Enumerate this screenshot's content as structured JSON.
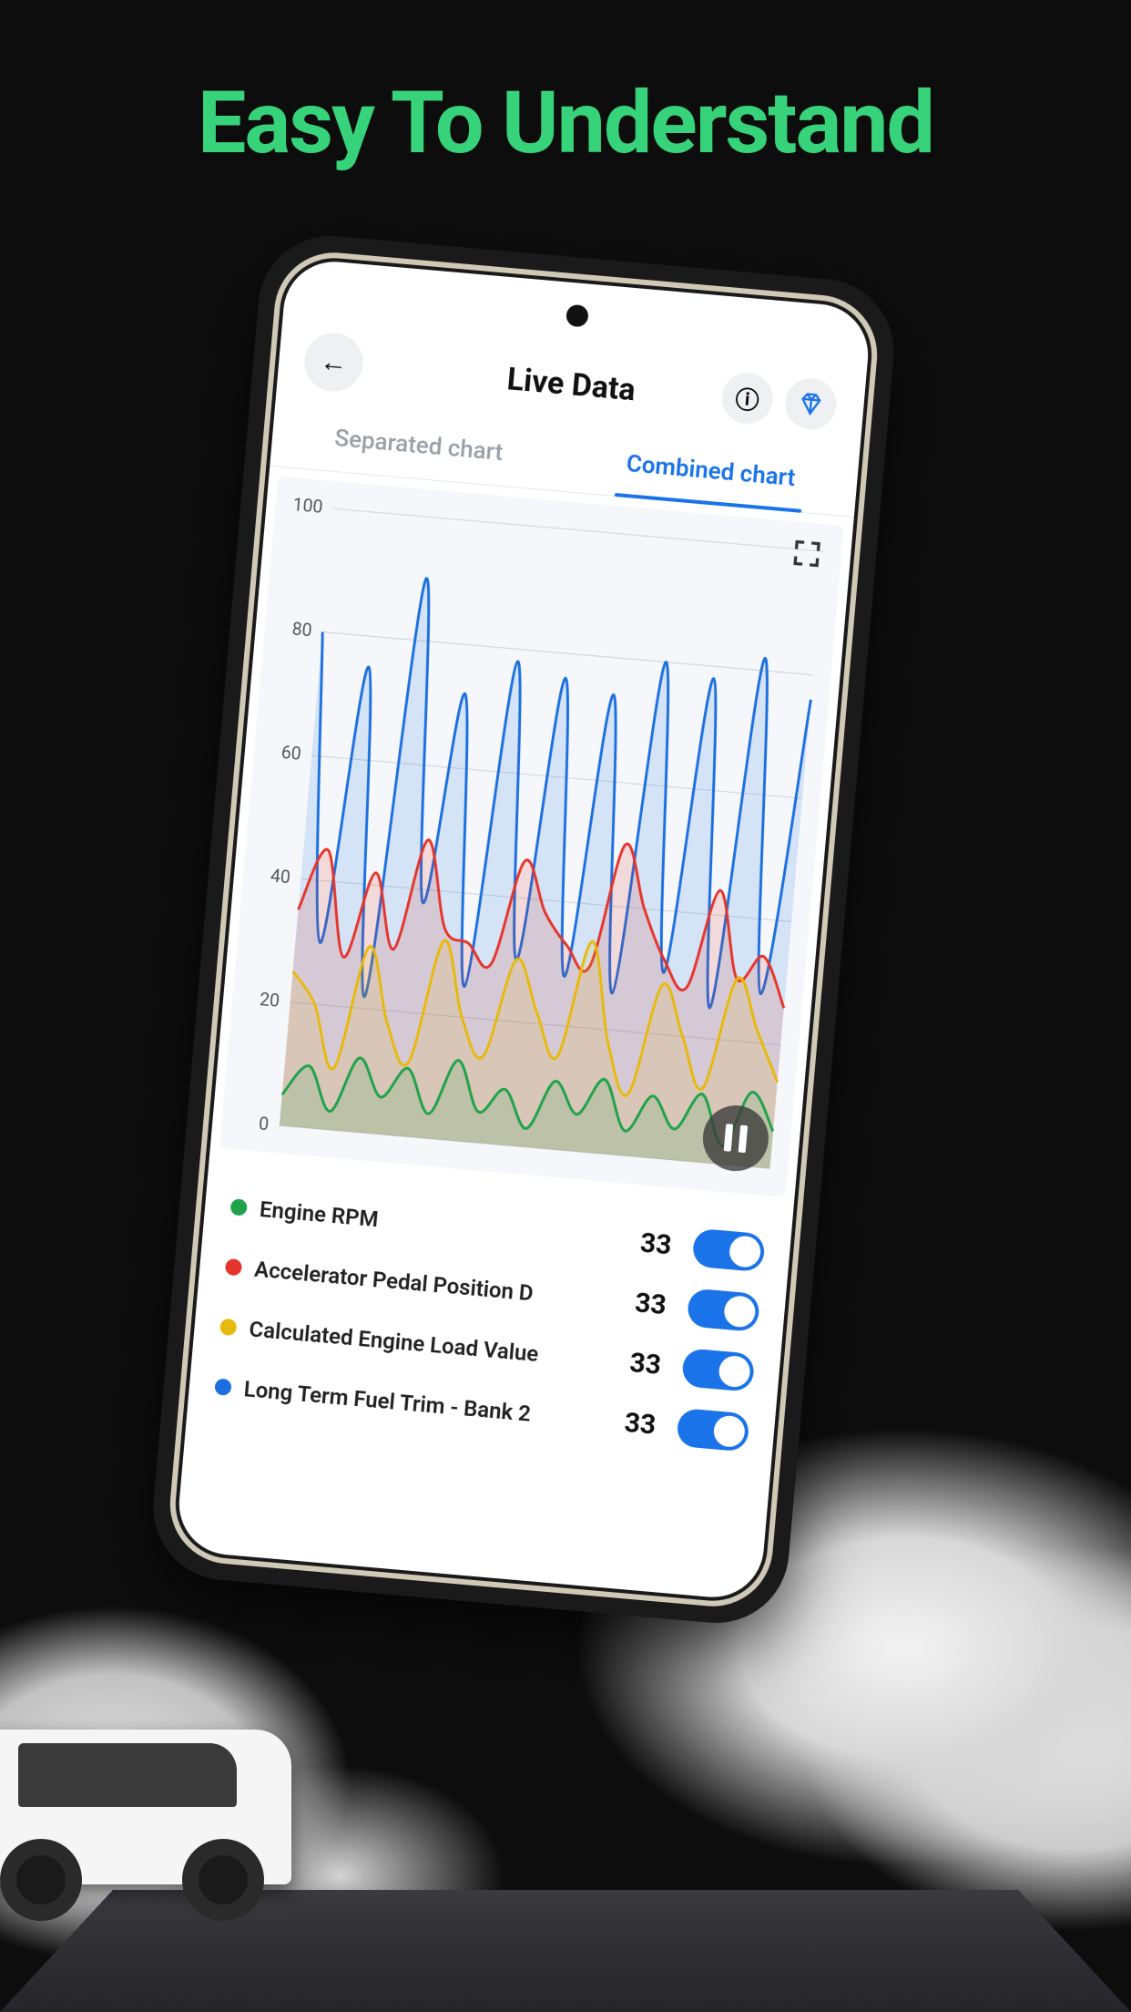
{
  "promo": {
    "headline": "Easy To Understand"
  },
  "header": {
    "title": "Live Data",
    "back_icon": "←",
    "info_icon": "ⓘ"
  },
  "tabs": [
    {
      "label": "Separated chart",
      "active": false
    },
    {
      "label": "Combined chart",
      "active": true
    }
  ],
  "chart_data": {
    "type": "line",
    "ylim": [
      0,
      100
    ],
    "yticks": [
      0,
      20,
      40,
      60,
      80,
      100
    ],
    "x": [
      0,
      1,
      2,
      3,
      4,
      5,
      6,
      7,
      8,
      9,
      10,
      11,
      12,
      13,
      14,
      15,
      16,
      17,
      18,
      19,
      20
    ],
    "series": [
      {
        "name": "Engine RPM",
        "color": "#1fa24a",
        "values": [
          5,
          10,
          3,
          12,
          6,
          11,
          4,
          13,
          5,
          9,
          3,
          11,
          6,
          12,
          4,
          10,
          5,
          11,
          3,
          12,
          6
        ]
      },
      {
        "name": "Accelerator Pedal Position D",
        "color": "#e5352b",
        "values": [
          35,
          45,
          28,
          42,
          30,
          48,
          34,
          32,
          29,
          46,
          38,
          33,
          30,
          50,
          40,
          32,
          28,
          44,
          30,
          34,
          26
        ]
      },
      {
        "name": "Calculated Engine Load Value",
        "color": "#e7b90c",
        "values": [
          25,
          20,
          10,
          30,
          18,
          12,
          32,
          20,
          14,
          30,
          22,
          15,
          34,
          18,
          10,
          28,
          20,
          12,
          30,
          22,
          14
        ]
      },
      {
        "name": "Long Term Fuel Trim - Bank 2",
        "color": "#1b6fe0",
        "values": [
          80,
          30,
          75,
          22,
          90,
          38,
          72,
          25,
          78,
          30,
          76,
          28,
          74,
          26,
          80,
          30,
          78,
          25,
          82,
          28,
          76
        ]
      }
    ]
  },
  "legend": [
    {
      "color": "#1fa24a",
      "label": "Engine RPM",
      "value": "33",
      "on": true
    },
    {
      "color": "#e5352b",
      "label": "Accelerator Pedal Position D",
      "value": "33",
      "on": true
    },
    {
      "color": "#e7b90c",
      "label": "Calculated Engine Load Value",
      "value": "33",
      "on": true
    },
    {
      "color": "#1b6fe0",
      "label": "Long Term Fuel Trim - Bank 2",
      "value": "33",
      "on": true
    }
  ]
}
